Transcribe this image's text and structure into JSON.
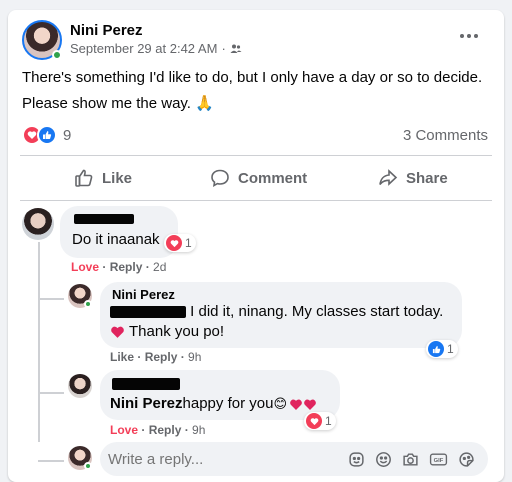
{
  "post": {
    "author": "Nini Perez",
    "timestamp": "September 29 at 2:42 AM",
    "separator": "·",
    "text_line1": "There's something I'd like to do, but I only have a day or so to decide.",
    "text_line2": "Please show me the way.",
    "emoji": "🙏",
    "reaction_count": "9",
    "comments_count": "3 Comments",
    "more_icon": "more-horizontal-icon",
    "audience_icon": "friends-audience-icon"
  },
  "actions": {
    "like": "Like",
    "comment": "Comment",
    "share": "Share"
  },
  "comments": [
    {
      "text": "Do it inaanak",
      "reaction_count": "1",
      "love": "Love",
      "reply": "Reply",
      "time": "2d"
    },
    {
      "name": "Nini Perez",
      "text_line1": " I did it, ninang. My classes start today.",
      "text_line2": "Thank you po!",
      "reaction_count": "1",
      "like": "Like",
      "reply": "Reply",
      "time": "9h"
    },
    {
      "tag": "Nini Perez",
      "text": " happy for you",
      "emojis": "😊",
      "reaction_count": "1",
      "love": "Love",
      "reply": "Reply",
      "time": "9h"
    }
  ],
  "reply_box": {
    "placeholder": "Write a reply..."
  },
  "colors": {
    "love": "#f33e58",
    "like_blue": "#1877f2",
    "muted": "#65676b",
    "online": "#31a24c"
  }
}
